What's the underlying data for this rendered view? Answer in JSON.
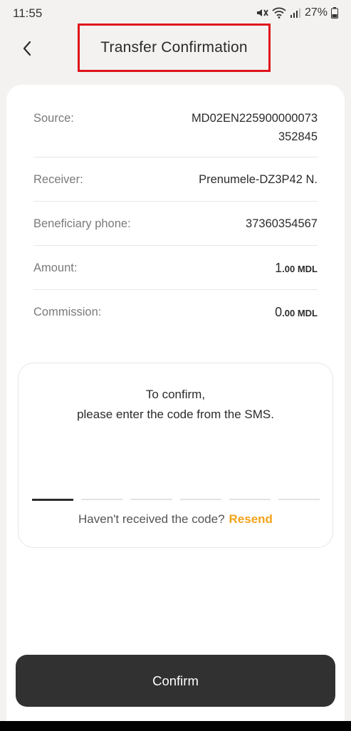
{
  "status_bar": {
    "time": "11:55",
    "battery": "27%",
    "icons": [
      "mute-icon",
      "wifi-icon",
      "signal-icon",
      "battery-icon"
    ]
  },
  "header": {
    "title": "Transfer Confirmation",
    "back_icon": "chevron-left-icon",
    "highlight_color": "#e0141c"
  },
  "details": {
    "source_label": "Source:",
    "source_value_line1": "MD02EN225900000073",
    "source_value_line2": "352845",
    "receiver_label": "Receiver:",
    "receiver_value": "Prenumele-DZ3P42 N.",
    "phone_label": "Beneficiary phone:",
    "phone_value": "37360354567",
    "amount_label": "Amount:",
    "amount_int": "1",
    "amount_dec": ".00 MDL",
    "commission_label": "Commission:",
    "commission_int": "0",
    "commission_dec": ".00 MDL"
  },
  "sms": {
    "line1": "To confirm,",
    "line2": "please enter the code from the SMS.",
    "slots": 6,
    "resend_prompt": "Haven't received the code?",
    "resend_link": "Resend",
    "accent_color": "#f2a31a"
  },
  "footer": {
    "confirm_label": "Confirm"
  }
}
